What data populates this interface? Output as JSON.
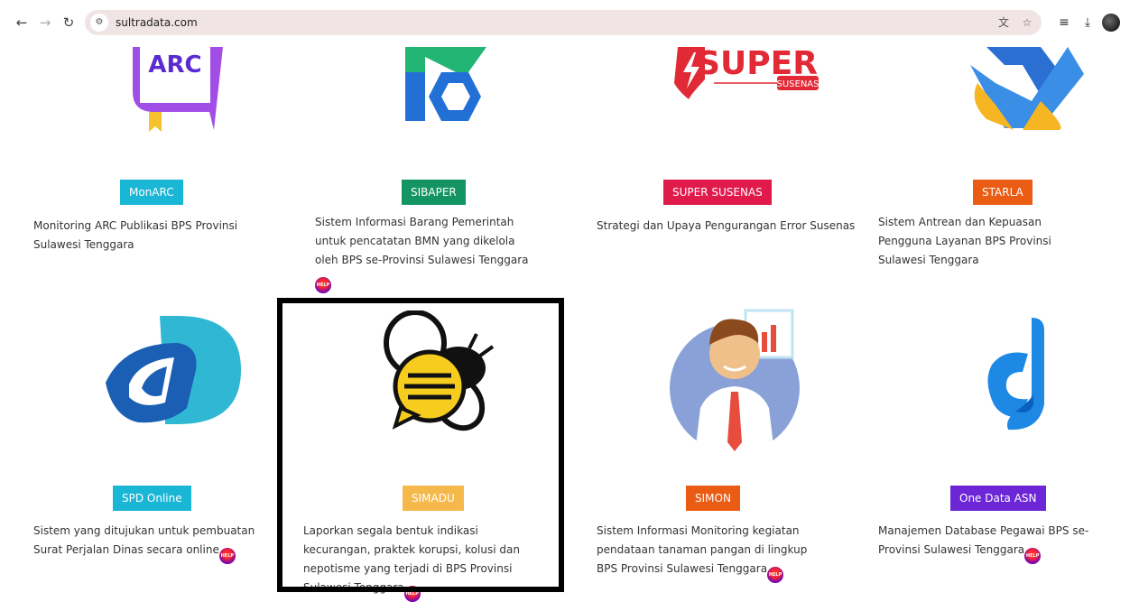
{
  "browser": {
    "url": "sultradata.com",
    "back_icon": "back-arrow-icon",
    "forward_icon": "forward-arrow-icon",
    "reload_icon": "reload-icon"
  },
  "cards": [
    {
      "title": "MonARC",
      "color": "#1ab6d5",
      "logo_text": "ARC",
      "desc": "Monitoring ARC Publikasi BPS Provinsi Sulawesi Tenggara",
      "help": false
    },
    {
      "title": "SIBAPER",
      "color": "#149463",
      "desc": "Sistem Informasi Barang Pemerintah untuk pencatatan BMN yang dikelola oleh BPS se-Provinsi Sulawesi Tenggara",
      "help": true
    },
    {
      "title": "SUPER SUSENAS",
      "color": "#e11a4c",
      "logo_text": "SUPER",
      "logo_subtext": "SUSENAS",
      "desc": "Strategi dan Upaya Pengurangan Error Susenas",
      "help": false
    },
    {
      "title": "STARLA",
      "color": "#ea5c14",
      "desc": "Sistem Antrean dan Kepuasan Pengguna Layanan BPS Provinsi Sulawesi Tenggara",
      "help": false
    },
    {
      "title": "SPD Online",
      "color": "#1ab6d5",
      "desc": "Sistem yang ditujukan untuk pembuatan Surat Perjalan Dinas secara online",
      "help": true
    },
    {
      "title": "SIMADU",
      "color": "#f5b84a",
      "desc": "Laporkan segala bentuk indikasi kecurangan, praktek korupsi, kolusi dan nepotisme yang terjadi di BPS Provinsi Sulawesi Tenggara",
      "help": true
    },
    {
      "title": "SIMON",
      "color": "#ea5c14",
      "desc": "Sistem Informasi Monitoring kegiatan pendataan tanaman pangan di lingkup BPS Provinsi Sulawesi Tenggara",
      "help": true
    },
    {
      "title": "One Data ASN",
      "color": "#6c26d6",
      "desc": "Manajemen Database Pegawai BPS se-Provinsi Sulawesi Tenggara",
      "help": true
    }
  ],
  "help_label": "HELP"
}
